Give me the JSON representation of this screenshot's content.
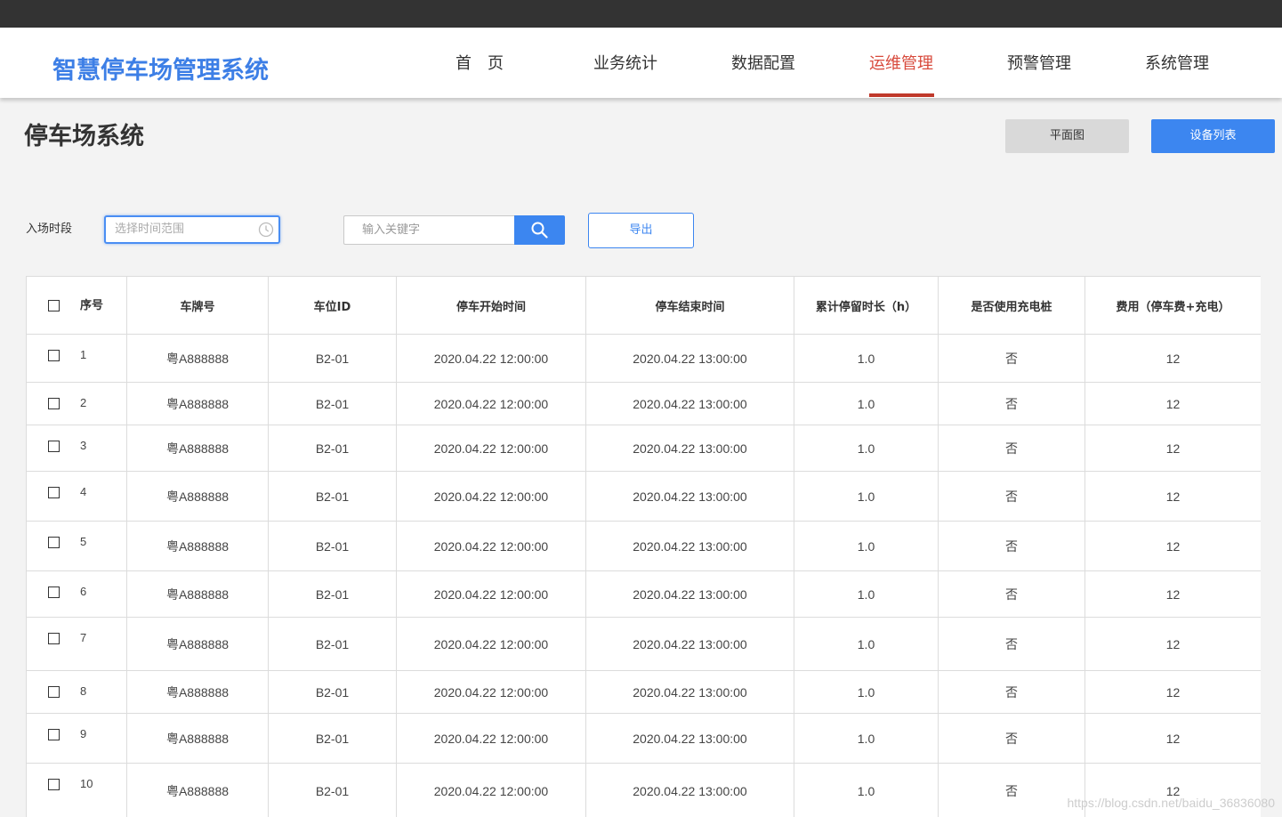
{
  "app": {
    "title": "智慧停车场管理系统"
  },
  "nav": {
    "items": [
      {
        "label": "首　页"
      },
      {
        "label": "业务统计"
      },
      {
        "label": "数据配置"
      },
      {
        "label": "运维管理",
        "active": true
      },
      {
        "label": "预警管理"
      },
      {
        "label": "系统管理"
      }
    ]
  },
  "page": {
    "title": "停车场系统",
    "plan_button": "平面图",
    "devices_button": "设备列表"
  },
  "filters": {
    "entry_label": "入场时段",
    "date_placeholder": "选择时间范围",
    "keyword_placeholder": "输入关键字",
    "export_label": "导出"
  },
  "table": {
    "columns": [
      "序号",
      "车牌号",
      "车位ID",
      "停车开始时间",
      "停车结束时间",
      "累计停留时长（h）",
      "是否使用充电桩",
      "费用（停车费+充电）"
    ],
    "rows": [
      {
        "idx": "1",
        "plate": "粤A888888",
        "slot": "B2-01",
        "start": "2020.04.22 12:00:00",
        "end": "2020.04.22 13:00:00",
        "hours": "1.0",
        "charging": "否",
        "fee": "12"
      },
      {
        "idx": "2",
        "plate": "粤A888888",
        "slot": "B2-01",
        "start": "2020.04.22 12:00:00",
        "end": "2020.04.22 13:00:00",
        "hours": "1.0",
        "charging": "否",
        "fee": "12"
      },
      {
        "idx": "3",
        "plate": "粤A888888",
        "slot": "B2-01",
        "start": "2020.04.22 12:00:00",
        "end": "2020.04.22 13:00:00",
        "hours": "1.0",
        "charging": "否",
        "fee": "12"
      },
      {
        "idx": "4",
        "plate": "粤A888888",
        "slot": "B2-01",
        "start": "2020.04.22 12:00:00",
        "end": "2020.04.22 13:00:00",
        "hours": "1.0",
        "charging": "否",
        "fee": "12"
      },
      {
        "idx": "5",
        "plate": "粤A888888",
        "slot": "B2-01",
        "start": "2020.04.22 12:00:00",
        "end": "2020.04.22 13:00:00",
        "hours": "1.0",
        "charging": "否",
        "fee": "12"
      },
      {
        "idx": "6",
        "plate": "粤A888888",
        "slot": "B2-01",
        "start": "2020.04.22 12:00:00",
        "end": "2020.04.22 13:00:00",
        "hours": "1.0",
        "charging": "否",
        "fee": "12"
      },
      {
        "idx": "7",
        "plate": "粤A888888",
        "slot": "B2-01",
        "start": "2020.04.22 12:00:00",
        "end": "2020.04.22 13:00:00",
        "hours": "1.0",
        "charging": "否",
        "fee": "12"
      },
      {
        "idx": "8",
        "plate": "粤A888888",
        "slot": "B2-01",
        "start": "2020.04.22 12:00:00",
        "end": "2020.04.22 13:00:00",
        "hours": "1.0",
        "charging": "否",
        "fee": "12"
      },
      {
        "idx": "9",
        "plate": "粤A888888",
        "slot": "B2-01",
        "start": "2020.04.22 12:00:00",
        "end": "2020.04.22 13:00:00",
        "hours": "1.0",
        "charging": "否",
        "fee": "12"
      },
      {
        "idx": "10",
        "plate": "粤A888888",
        "slot": "B2-01",
        "start": "2020.04.22 12:00:00",
        "end": "2020.04.22 13:00:00",
        "hours": "1.0",
        "charging": "否",
        "fee": "12"
      }
    ]
  },
  "watermark": "https://blog.csdn.net/baidu_36836080",
  "colors": {
    "accent": "#3c86f0",
    "logo": "#3d7fe6",
    "active_nav": "#d84a3c",
    "topbar": "#333333"
  },
  "icons": {
    "date": "clock-icon",
    "search": "search-icon"
  }
}
